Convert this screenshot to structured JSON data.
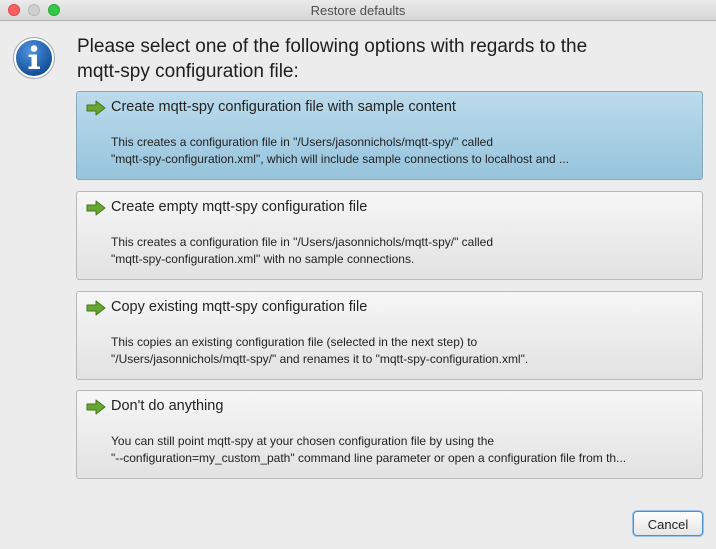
{
  "window": {
    "title": "Restore defaults"
  },
  "header": {
    "line1": "Please select one of the following options with regards to the",
    "line2": "mqtt-spy configuration file:"
  },
  "options": [
    {
      "title": "Create mqtt-spy configuration file with sample content",
      "desc1": "This creates a configuration file in \"/Users/jasonnichols/mqtt-spy/\" called",
      "desc2": "\"mqtt-spy-configuration.xml\", which will include sample connections to localhost and ...",
      "selected": true
    },
    {
      "title": "Create empty mqtt-spy configuration file",
      "desc1": "This creates a configuration file in \"/Users/jasonnichols/mqtt-spy/\" called",
      "desc2": "\"mqtt-spy-configuration.xml\" with no sample connections."
    },
    {
      "title": "Copy existing mqtt-spy configuration file",
      "desc1": "This copies an existing configuration file (selected in the next step) to",
      "desc2": "\"/Users/jasonnichols/mqtt-spy/\" and renames it to \"mqtt-spy-configuration.xml\"."
    },
    {
      "title": "Don't do anything",
      "desc1": "You can still point mqtt-spy at your chosen configuration file by using the",
      "desc2": "\"--configuration=my_custom_path\" command line parameter or open a configuration file from th..."
    }
  ],
  "buttons": {
    "cancel": "Cancel"
  },
  "icons": {
    "info": "info-icon",
    "option_arrow": "green-arrow-icon"
  },
  "colors": {
    "selected_option": "#a9d0e6",
    "arrow": "#6aa532",
    "info_icon": "#1c5ea8"
  }
}
